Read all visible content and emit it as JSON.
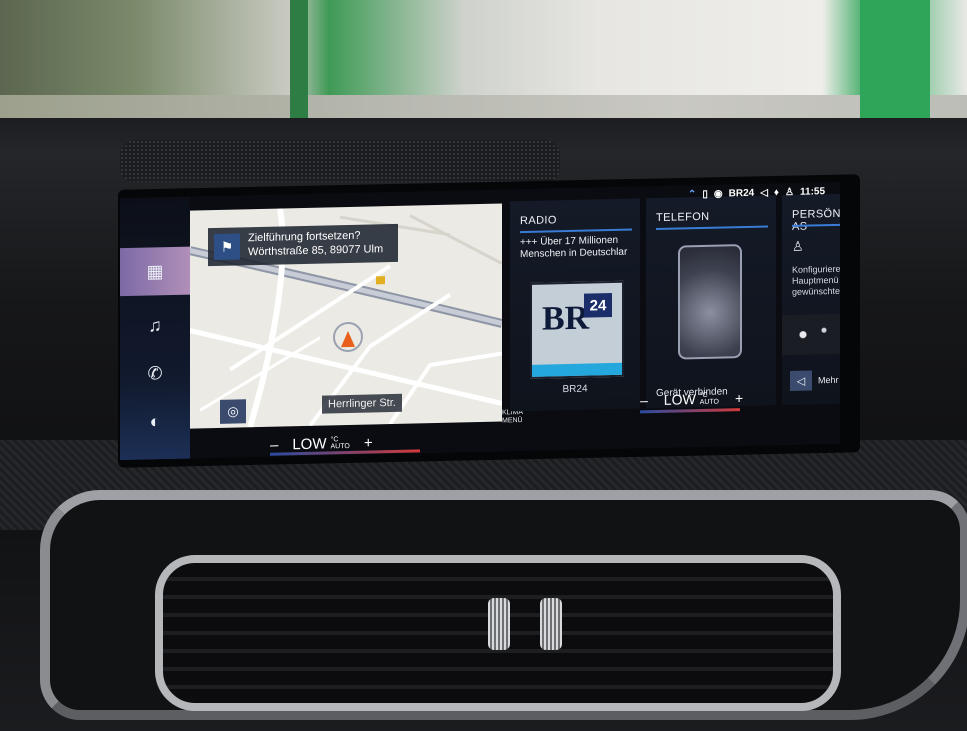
{
  "nav_rail": {
    "items": [
      {
        "icon": "apps-grid-icon",
        "glyph": "▦",
        "active": true
      },
      {
        "icon": "music-note-icon",
        "glyph": "♫",
        "active": false
      },
      {
        "icon": "phone-icon",
        "glyph": "✆",
        "active": false
      },
      {
        "icon": "navigation-icon",
        "glyph": "◐",
        "active": false
      }
    ]
  },
  "navigation": {
    "banner_title": "Zielführung fortsetzen?",
    "banner_address": "Wörthstraße 85, 89077 Ulm",
    "current_street": "Herrlinger Str.",
    "recenter_glyph": "◎",
    "flag_glyph": "⚑"
  },
  "climate_left": {
    "minus": "–",
    "level": "LOW",
    "unit_top": "°C",
    "unit_bottom": "AUTO",
    "plus": "+"
  },
  "climate_right": {
    "minus": "–",
    "level": "LOW",
    "unit_top": "°C",
    "unit_bottom": "AUTO",
    "plus": "+"
  },
  "klima_menu": {
    "line1": "KLIMA",
    "line2": "MENÜ"
  },
  "radio_card": {
    "title": "RADIO",
    "text_line1": "+++ Über 17 Millionen",
    "text_line2": "Menschen in Deutschlar",
    "logo_br": "BR",
    "logo_24": "24",
    "station_name": "BR24"
  },
  "phone_card": {
    "title": "TELEFON",
    "connect_label": "Gerät verbinden"
  },
  "personal_card": {
    "title": "PERSÖNL. AS",
    "text_line1": "Konfigurierer",
    "text_line2": "Hauptmenü r",
    "text_line3": "gewünschter",
    "more_label": "Mehr"
  },
  "status_bar": {
    "station": "BR24",
    "time": "11:55"
  },
  "colors": {
    "accent_blue": "#3a7bd5",
    "active_rail": "#9c7eb2",
    "heat_red": "#d23a3a"
  }
}
